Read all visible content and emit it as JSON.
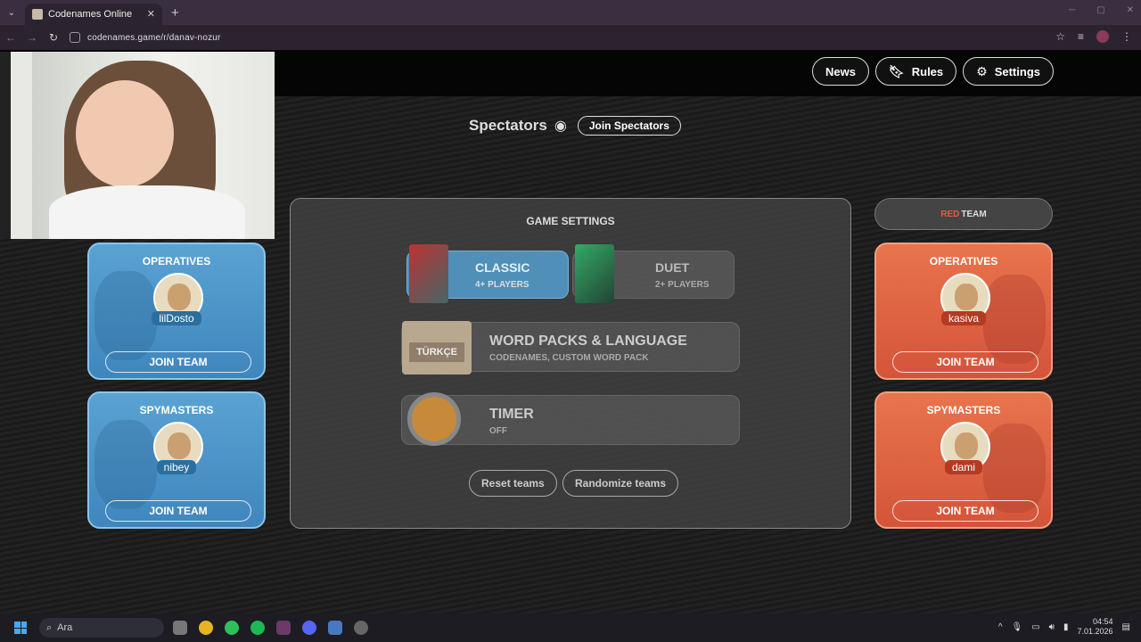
{
  "browser": {
    "tab_title": "Codenames Online",
    "url": "codenames.game/r/danav-nozur"
  },
  "header": {
    "news": "News",
    "rules": "Rules",
    "settings": "Settings"
  },
  "spectators": {
    "label": "Spectators",
    "join": "Join Spectators"
  },
  "game_settings": {
    "title": "GAME SETTINGS",
    "modes": [
      {
        "name": "CLASSIC",
        "sub": "4+ PLAYERS"
      },
      {
        "name": "DUET",
        "sub": "2+ PLAYERS"
      }
    ],
    "word_packs": {
      "name": "WORD PACKS & LANGUAGE",
      "sub": "CODENAMES, CUSTOM WORD PACK",
      "language": "TÜRKÇE"
    },
    "timer": {
      "name": "TIMER",
      "sub": "OFF"
    },
    "reset": "Reset teams",
    "randomize": "Randomize teams"
  },
  "blue_team": {
    "operatives": {
      "title": "OPERATIVES",
      "player": "lilDosto",
      "join": "JOIN TEAM"
    },
    "spymasters": {
      "title": "SPYMASTERS",
      "player": "nibey",
      "join": "JOIN TEAM"
    }
  },
  "red_team": {
    "label_red": "RED",
    "label_team": "TEAM",
    "operatives": {
      "title": "OPERATIVES",
      "player": "kasiva",
      "join": "JOIN TEAM"
    },
    "spymasters": {
      "title": "SPYMASTERS",
      "player": "dami",
      "join": "JOIN TEAM"
    }
  },
  "taskbar": {
    "search": "Ara",
    "time": "04:54",
    "date": "7.01.2026"
  },
  "colors": {
    "blue": "#4f96c8",
    "red": "#e0643f",
    "panel": "#464646"
  }
}
